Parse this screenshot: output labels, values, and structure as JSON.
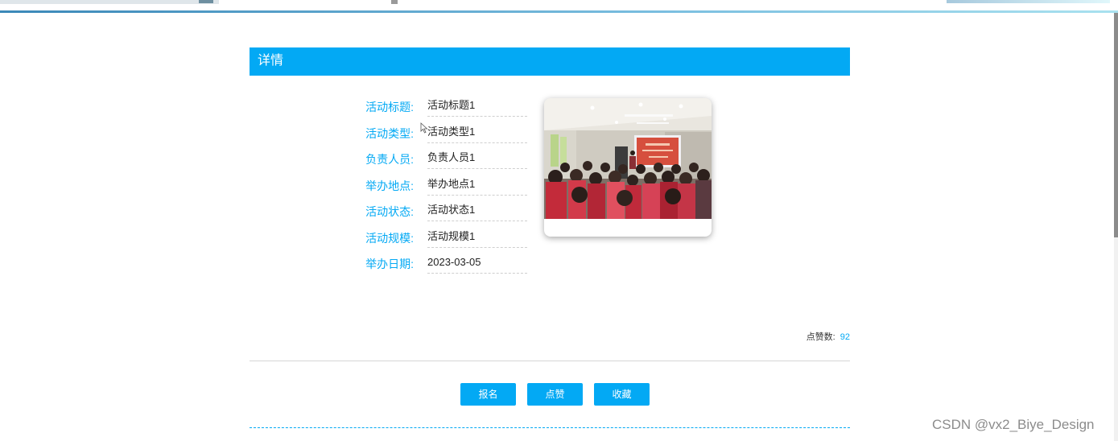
{
  "section": {
    "title": "详情"
  },
  "details": [
    {
      "label": "活动标题:",
      "value": "活动标题1"
    },
    {
      "label": "活动类型:",
      "value": "活动类型1"
    },
    {
      "label": "负责人员:",
      "value": "负责人员1"
    },
    {
      "label": "举办地点:",
      "value": "举办地点1"
    },
    {
      "label": "活动状态:",
      "value": "活动状态1"
    },
    {
      "label": "活动规模:",
      "value": "活动规模1"
    },
    {
      "label": "举办日期:",
      "value": "2023-03-05"
    }
  ],
  "likes": {
    "label": "点赞数:",
    "value": "92"
  },
  "actions": {
    "signup": "报名",
    "like": "点赞",
    "favorite": "收藏"
  },
  "watermark": "CSDN @vx2_Biye_Design",
  "colors": {
    "accent": "#03a9f4",
    "divider": "#d6d6d6"
  }
}
